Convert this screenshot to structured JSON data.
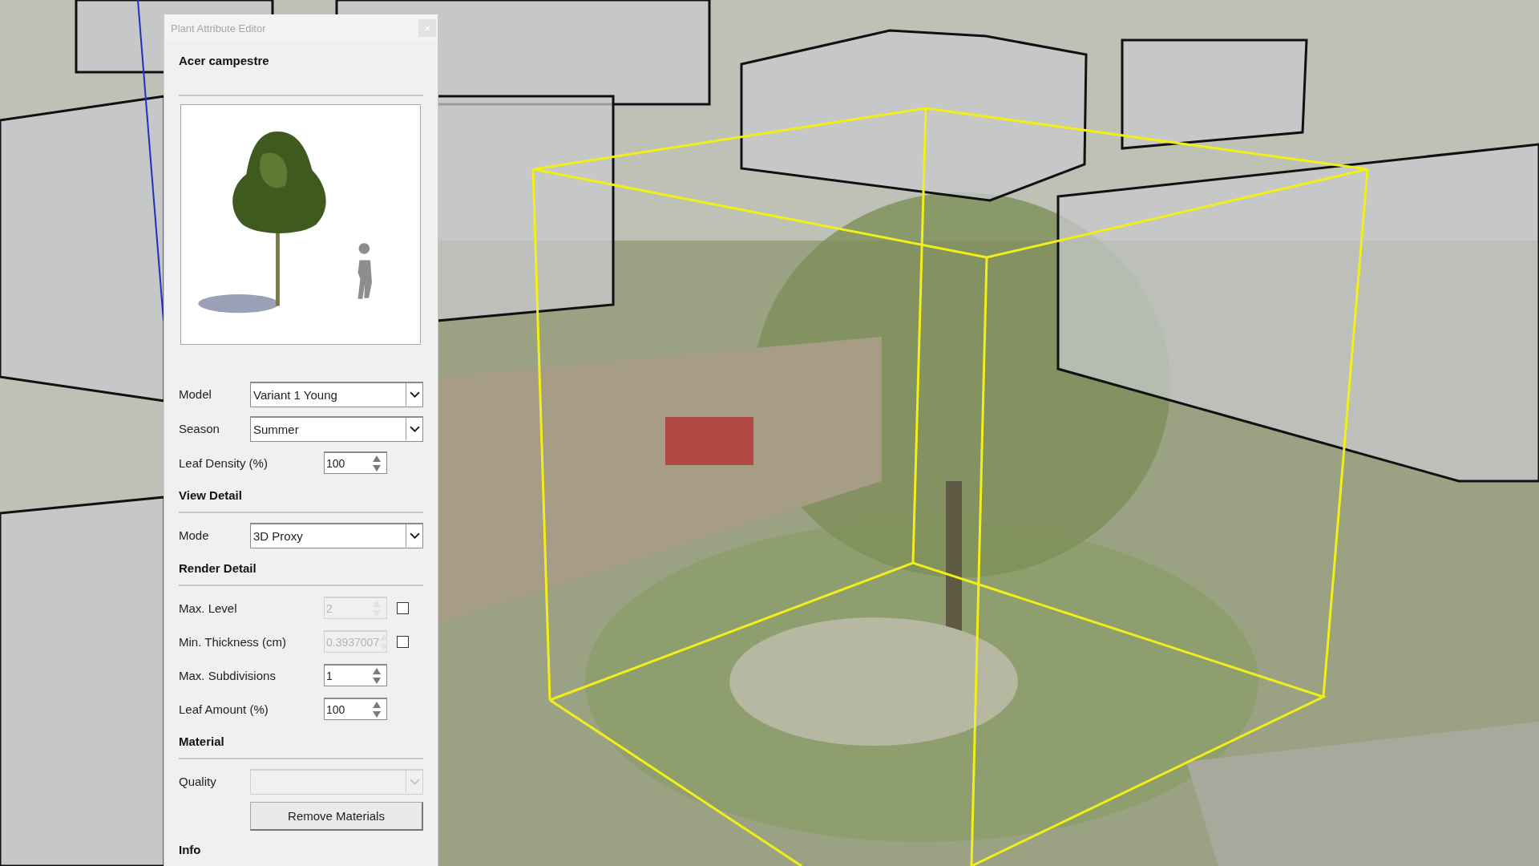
{
  "dialog": {
    "title": "Plant Attribute Editor",
    "plant_name": "Acer campestre",
    "sections": [
      {
        "rows": [
          {
            "kind": "combo",
            "label": "Model",
            "value": "Variant 1 Young",
            "disabled": false
          },
          {
            "kind": "combo",
            "label": "Season",
            "value": "Summer",
            "disabled": false
          },
          {
            "kind": "spin",
            "label": "Leaf Density (%)",
            "value": "100",
            "disabled": false
          }
        ]
      },
      {
        "heading": "View Detail",
        "rows": [
          {
            "kind": "combo",
            "label": "Mode",
            "value": "3D Proxy",
            "disabled": false
          }
        ]
      },
      {
        "heading": "Render Detail",
        "rows": [
          {
            "kind": "spin",
            "label": "Max. Level",
            "value": "2",
            "disabled": true,
            "checkbox": {
              "checked": false
            }
          },
          {
            "kind": "spin",
            "label": "Min. Thickness (cm)",
            "value": "0.3937007",
            "disabled": true,
            "checkbox": {
              "checked": false
            }
          },
          {
            "kind": "spin",
            "label": "Max. Subdivisions",
            "value": "1",
            "disabled": false
          },
          {
            "kind": "spin",
            "label": "Leaf Amount (%)",
            "value": "100",
            "disabled": false
          }
        ]
      },
      {
        "heading": "Material",
        "rows": [
          {
            "kind": "combo",
            "label": "Quality",
            "disabled": true
          },
          {
            "kind": "button",
            "label": "Remove Materials"
          }
        ]
      },
      {
        "heading": "Info"
      }
    ]
  }
}
